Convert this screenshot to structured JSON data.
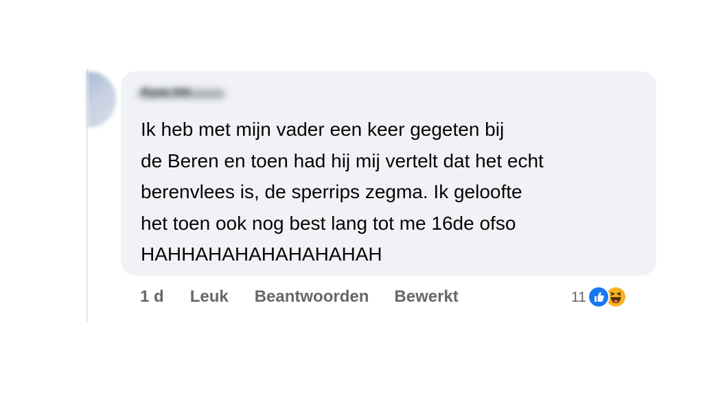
{
  "comment": {
    "author_redacted": "Ryan NN",
    "text_lines": [
      "Ik heb met mijn vader een keer gegeten bij",
      "de Beren en toen had hij mij vertelt dat het echt",
      "berenvlees is, de sperrips zegma. Ik geloofte",
      "het toen ook nog best lang tot me 16de ofso",
      "HAHHAHAHAHAHAHAHAH"
    ]
  },
  "actions": {
    "time": "1 d",
    "like_label": "Leuk",
    "reply_label": "Beantwoorden",
    "edited_label": "Bewerkt"
  },
  "reactions": {
    "count": "11",
    "types": [
      "like-icon",
      "haha-icon"
    ],
    "like_color": "#1877f2",
    "haha_color": "#f7b125"
  },
  "colors": {
    "bubble": "#f0f2f5",
    "text": "#050505",
    "secondary_text": "#65676b"
  }
}
